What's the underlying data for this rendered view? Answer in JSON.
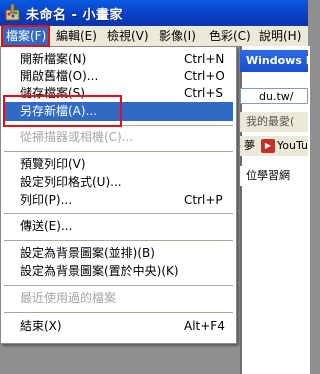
{
  "window": {
    "title": "未命名 - 小畫家",
    "icon": "paint-palette-icon"
  },
  "menubar": [
    {
      "label": "檔案(F)",
      "active": true
    },
    {
      "label": "編輯(E)"
    },
    {
      "label": "檢視(V)"
    },
    {
      "label": "影像(I)"
    },
    {
      "label": "色彩(C)"
    },
    {
      "label": "說明(H)"
    }
  ],
  "file_menu": [
    {
      "label": "開新檔案(N)",
      "shortcut": "Ctrl+N"
    },
    {
      "label": "開啟舊檔(O)...",
      "shortcut": "Ctrl+O"
    },
    {
      "label": "儲存檔案(S)",
      "shortcut": "Ctrl+S"
    },
    {
      "label": "另存新檔(A)...",
      "shortcut": "",
      "selected": true
    },
    {
      "separator": true
    },
    {
      "label": "從掃描器或相機(C)...",
      "shortcut": "",
      "disabled": true
    },
    {
      "separator": true
    },
    {
      "label": "預覽列印(V)",
      "shortcut": ""
    },
    {
      "label": "設定列印格式(U)...",
      "shortcut": ""
    },
    {
      "label": "列印(P)...",
      "shortcut": "Ctrl+P"
    },
    {
      "separator": true
    },
    {
      "label": "傳送(E)...",
      "shortcut": ""
    },
    {
      "separator": true
    },
    {
      "label": "設定為背景圖案(並排)(B)",
      "shortcut": ""
    },
    {
      "label": "設定為背景圖案(置於中央)(K)",
      "shortcut": ""
    },
    {
      "separator": true
    },
    {
      "label": "最近使用過的檔案",
      "shortcut": "",
      "disabled": true
    },
    {
      "separator": true
    },
    {
      "label": "結束(X)",
      "shortcut": "Alt+F4"
    }
  ],
  "background_window": {
    "title": "Windows In",
    "url_fragment": "du.tw/",
    "favorites": "我的最愛(",
    "links_text": "夢",
    "youtube_icon": "youtube-icon",
    "youtube_label": "YouTu",
    "site_text": "位學習網"
  },
  "colors": {
    "highlight": "#316ac5",
    "annotation": "#e0101c",
    "titlebar": "#0a4ad0"
  }
}
